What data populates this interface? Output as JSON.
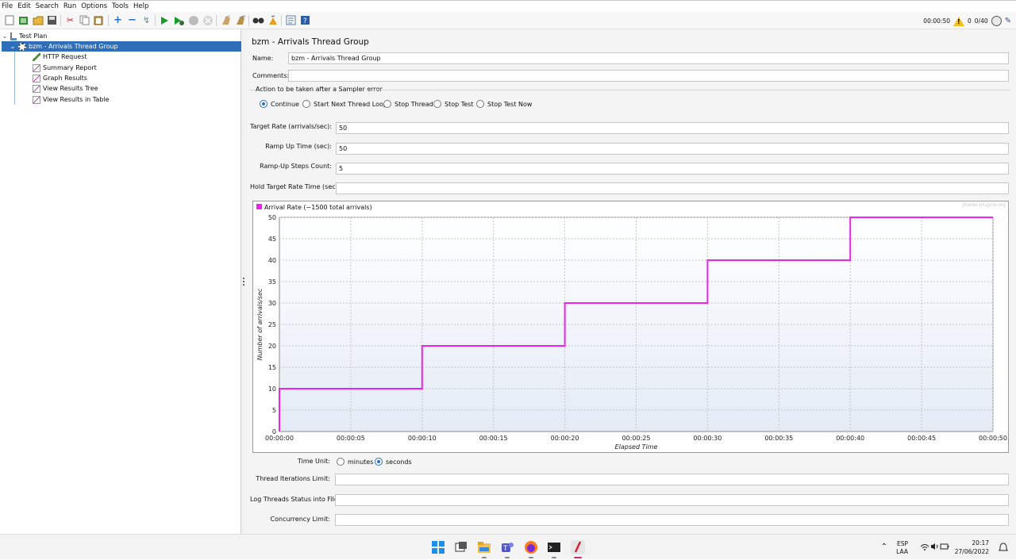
{
  "menu": [
    "File",
    "Edit",
    "Search",
    "Run",
    "Options",
    "Tools",
    "Help"
  ],
  "toolbar_status": {
    "timer": "00:00:50",
    "warnings": "0",
    "threads": "0/40"
  },
  "tree": {
    "items": [
      {
        "label": "Test Plan",
        "icon": "flask-icon"
      },
      {
        "label": "bzm - Arrivals Thread Group",
        "icon": "gear-icon",
        "selected": true
      },
      {
        "label": "HTTP Request",
        "icon": "pipette-icon"
      },
      {
        "label": "Summary Report",
        "icon": "graph-icon"
      },
      {
        "label": "Graph Results",
        "icon": "graph-icon"
      },
      {
        "label": "View Results Tree",
        "icon": "graph-icon"
      },
      {
        "label": "View Results in Table",
        "icon": "graph-icon"
      }
    ]
  },
  "panel": {
    "title": "bzm - Arrivals Thread Group",
    "name_label": "Name:",
    "name_value": "bzm - Arrivals Thread Group",
    "comments_label": "Comments:",
    "comments_value": "",
    "action_label": "Action to be taken after a Sampler error",
    "actions": [
      {
        "label": "Continue",
        "selected": true
      },
      {
        "label": "Start Next Thread Loop",
        "selected": false
      },
      {
        "label": "Stop Thread",
        "selected": false
      },
      {
        "label": "Stop Test",
        "selected": false
      },
      {
        "label": "Stop Test Now",
        "selected": false
      }
    ],
    "target_rate_label": "Target Rate (arrivals/sec):",
    "target_rate_value": "50",
    "ramp_up_label": "Ramp Up Time (sec):",
    "ramp_up_value": "50",
    "steps_label": "Ramp-Up Steps Count:",
    "steps_value": "5",
    "hold_label": "Hold Target Rate Time (sec):",
    "hold_value": "",
    "time_unit_label": "Time Unit:",
    "time_units": [
      {
        "label": "minutes",
        "selected": false
      },
      {
        "label": "seconds",
        "selected": true
      }
    ],
    "iterations_label": "Thread Iterations Limit:",
    "iterations_value": "",
    "log_label": "Log Threads Status into File:",
    "log_value": "",
    "concurrency_label": "Concurrency Limit:",
    "concurrency_value": ""
  },
  "chart_data": {
    "type": "line",
    "watermark": "jmeter-plugins.org",
    "xlabel": "Elapsed Time",
    "ylabel": "Number of arrivals/sec",
    "ylim": [
      0,
      50
    ],
    "xlim": [
      0,
      50
    ],
    "x_ticks": [
      "00:00:00",
      "00:00:05",
      "00:00:10",
      "00:00:15",
      "00:00:20",
      "00:00:25",
      "00:00:30",
      "00:00:35",
      "00:00:40",
      "00:00:45",
      "00:00:50"
    ],
    "y_ticks": [
      0,
      5,
      10,
      15,
      20,
      25,
      30,
      35,
      40,
      45,
      50
    ],
    "grid": true,
    "legend": "top-left",
    "series": [
      {
        "name": "Arrival Rate (~1500 total arrivals)",
        "color": "#ee22ee",
        "points": [
          [
            0,
            0
          ],
          [
            0,
            10
          ],
          [
            10,
            10
          ],
          [
            10,
            20
          ],
          [
            20,
            20
          ],
          [
            20,
            30
          ],
          [
            30,
            30
          ],
          [
            30,
            40
          ],
          [
            40,
            40
          ],
          [
            40,
            50
          ],
          [
            50,
            50
          ]
        ]
      }
    ]
  },
  "taskbar": {
    "lang": "ESP",
    "layout": "LAA",
    "time": "20:17",
    "date": "27/06/2022"
  }
}
